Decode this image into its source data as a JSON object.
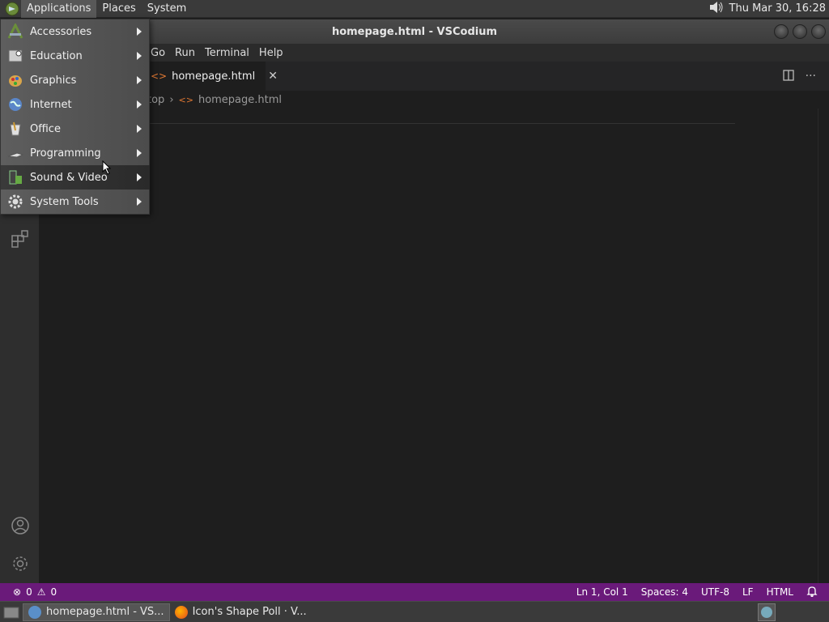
{
  "top_panel": {
    "menus": [
      "Applications",
      "Places",
      "System"
    ],
    "clock": "Thu Mar 30, 16:28"
  },
  "window": {
    "title": "homepage.html - VSCodium"
  },
  "menubar": {
    "items": [
      "Go",
      "Run",
      "Terminal",
      "Help"
    ]
  },
  "tab": {
    "label": "homepage.html"
  },
  "breadcrumb": {
    "folder": "top",
    "file": "homepage.html"
  },
  "app_menu": {
    "items": [
      {
        "label": "Accessories",
        "icon": "accessories-icon"
      },
      {
        "label": "Education",
        "icon": "education-icon"
      },
      {
        "label": "Graphics",
        "icon": "graphics-icon"
      },
      {
        "label": "Internet",
        "icon": "internet-icon"
      },
      {
        "label": "Office",
        "icon": "office-icon"
      },
      {
        "label": "Programming",
        "icon": "programming-icon"
      },
      {
        "label": "Sound & Video",
        "icon": "sound-video-icon"
      },
      {
        "label": "System Tools",
        "icon": "system-tools-icon"
      }
    ],
    "highlighted": "Sound & Video"
  },
  "statusbar": {
    "errors": "0",
    "warnings": "0",
    "position": "Ln 1, Col 1",
    "spaces": "Spaces: 4",
    "encoding": "UTF-8",
    "eol": "LF",
    "language": "HTML"
  },
  "taskbar": {
    "tasks": [
      "homepage.html - VS...",
      "Icon's Shape Poll · V..."
    ]
  },
  "colors": {
    "statusbar": "#6a1a7a",
    "editor_bg": "#1e1e1e",
    "panel_bg": "#3a3a3a"
  }
}
